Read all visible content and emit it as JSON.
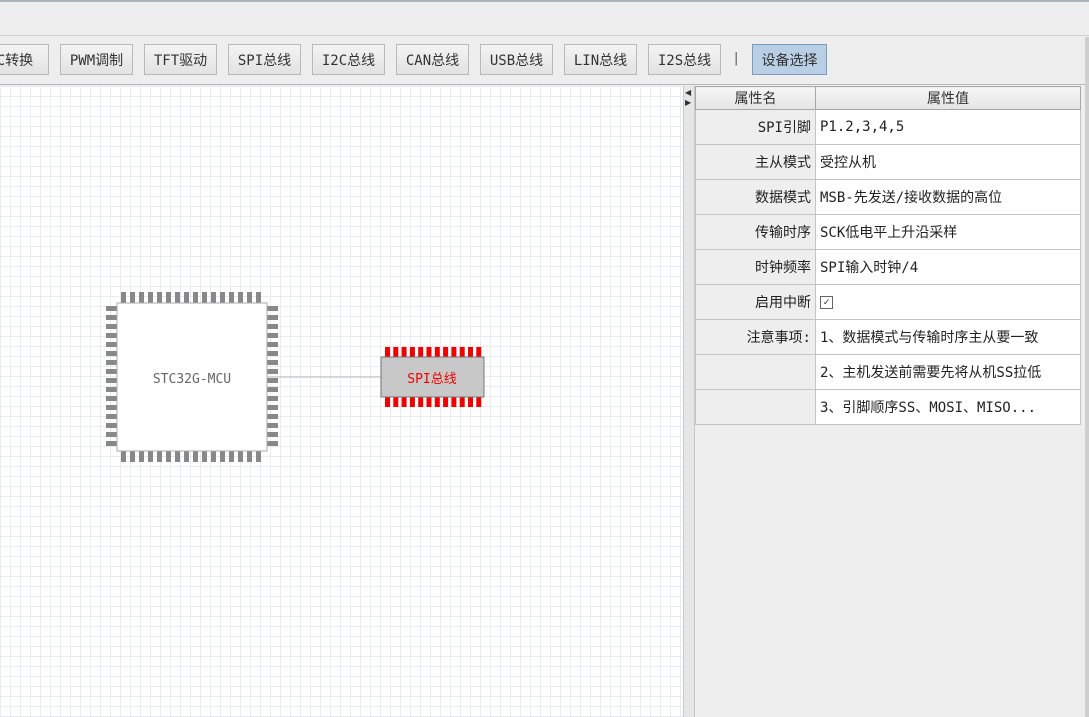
{
  "toolbar": {
    "buttons": [
      {
        "label": "DAC转换"
      },
      {
        "label": "PWM调制"
      },
      {
        "label": "TFT驱动"
      },
      {
        "label": "SPI总线"
      },
      {
        "label": "I2C总线"
      },
      {
        "label": "CAN总线"
      },
      {
        "label": "USB总线"
      },
      {
        "label": "LIN总线"
      },
      {
        "label": "I2S总线"
      }
    ],
    "separator": "|",
    "device_select_label": "设备选择"
  },
  "canvas": {
    "mcu_label": "STC32G-MCU",
    "spi_label": "SPI总线",
    "spi_color": "#ee0000"
  },
  "properties": {
    "header_name": "属性名",
    "header_value": "属性值",
    "rows": [
      {
        "name": "SPI引脚",
        "value": "P1.2,3,4,5"
      },
      {
        "name": "主从模式",
        "value": "受控从机"
      },
      {
        "name": "数据模式",
        "value": "MSB-先发送/接收数据的高位"
      },
      {
        "name": "传输时序",
        "value": "SCK低电平上升沿采样"
      },
      {
        "name": "时钟频率",
        "value": "SPI输入时钟/4"
      },
      {
        "name": "启用中断",
        "checked": true
      },
      {
        "name": "注意事项:",
        "value": "1、数据模式与传输时序主从要一致"
      },
      {
        "name": "",
        "value": "2、主机发送前需要先将从机SS拉低"
      },
      {
        "name": "",
        "value": "3、引脚顺序SS、MOSI、MISO..."
      }
    ]
  }
}
